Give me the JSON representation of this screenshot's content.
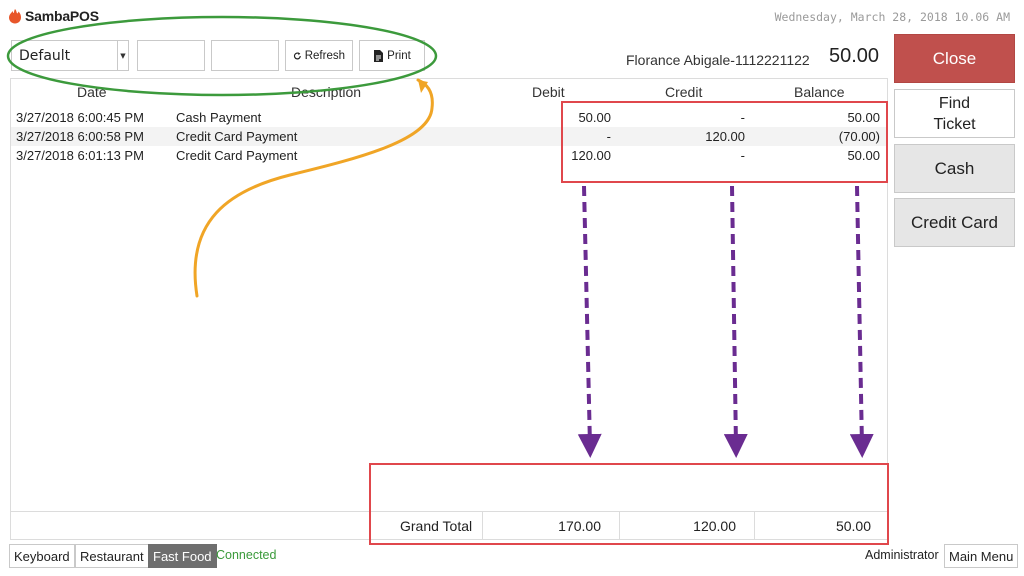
{
  "app": {
    "name": "SambaPOS",
    "logo_icon": "flame-logo-icon",
    "date_time": "Wednesday, March 28, 2018 10.06 AM"
  },
  "toolbar": {
    "filter_value": "Default",
    "start_date_value": "",
    "end_date_value": "",
    "refresh_label": "Refresh",
    "print_label": "Print",
    "refresh_icon": "refresh-icon",
    "print_icon": "document-print-icon"
  },
  "customer": {
    "name": "Florance Abigale-1112221122",
    "balance": "50.00"
  },
  "table": {
    "headers": {
      "date": "Date",
      "description": "Description",
      "debit": "Debit",
      "credit": "Credit",
      "balance": "Balance"
    },
    "rows": [
      {
        "date": "3/27/2018 6:00:45 PM",
        "description": "Cash Payment",
        "debit": "50.00",
        "credit": "-",
        "balance": "50.00"
      },
      {
        "date": "3/27/2018 6:00:58 PM",
        "description": "Credit Card Payment",
        "debit": "-",
        "credit": "120.00",
        "balance": "(70.00)"
      },
      {
        "date": "3/27/2018 6:01:13 PM",
        "description": "Credit Card Payment",
        "debit": "120.00",
        "credit": "-",
        "balance": "50.00"
      }
    ],
    "grand_total": {
      "label": "Grand Total",
      "debit": "170.00",
      "credit": "120.00",
      "balance": "50.00"
    }
  },
  "side_buttons": {
    "close": "Close",
    "find_ticket_line1": "Find",
    "find_ticket_line2": "Ticket",
    "cash": "Cash",
    "credit_card": "Credit Card"
  },
  "status_bar": {
    "keyboard": "Keyboard",
    "restaurant": "Restaurant",
    "fast_food": "Fast Food",
    "connection": "Connected",
    "user": "Administrator",
    "main_menu": "Main Menu"
  },
  "colors": {
    "close_button": "#c0504d",
    "connected_text": "#3a9a3a",
    "fast_food_active": "#6e6e6e",
    "annotation_ellipse": "#3c9a3c",
    "annotation_box": "#e0474c",
    "annotation_curve": "#f0a526",
    "annotation_arrows": "#6a2c91"
  }
}
